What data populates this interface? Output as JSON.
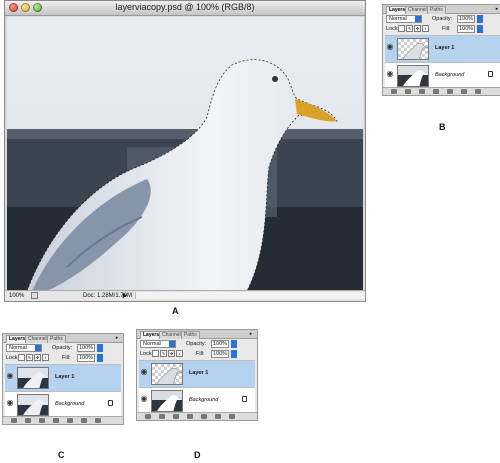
{
  "document_window": {
    "title": "layerviacopy.psd @ 100% (RGB/8)",
    "zoom": "100%",
    "doc_info": "Doc: 1.28M/1.79M"
  },
  "figure_labels": {
    "a": "A",
    "b": "B",
    "c": "C",
    "d": "D"
  },
  "palettes": {
    "b": {
      "tabs": [
        "Layers",
        "Channels",
        "Paths"
      ],
      "blend_mode": "Normal",
      "opacity_label": "Opacity:",
      "opacity_value": "100%",
      "lock_label": "Lock:",
      "fill_label": "Fill:",
      "fill_value": "100%",
      "layers": [
        {
          "name": "Layer 1",
          "selected": true
        },
        {
          "name": "Background",
          "locked": true
        }
      ]
    },
    "c": {
      "tabs": [
        "Layers",
        "Channels",
        "Paths"
      ],
      "blend_mode": "Normal",
      "opacity_label": "Opacity:",
      "opacity_value": "100%",
      "lock_label": "Lock:",
      "fill_label": "Fill:",
      "fill_value": "100%",
      "layers": [
        {
          "name": "Layer 1",
          "selected": true
        },
        {
          "name": "Background",
          "locked": true
        }
      ]
    },
    "d": {
      "tabs": [
        "Layers",
        "Channels",
        "Paths"
      ],
      "blend_mode": "Normal",
      "opacity_label": "Opacity:",
      "opacity_value": "100%",
      "lock_label": "Lock:",
      "fill_label": "Fill:",
      "fill_value": "100%",
      "layers": [
        {
          "name": "Layer 1",
          "selected": true
        },
        {
          "name": "Background",
          "locked": true
        }
      ]
    }
  },
  "colors": {
    "selected_layer": "#b5d3ee",
    "accent_blue": "#2a73d8",
    "window_chrome": "#d8d8d8"
  }
}
